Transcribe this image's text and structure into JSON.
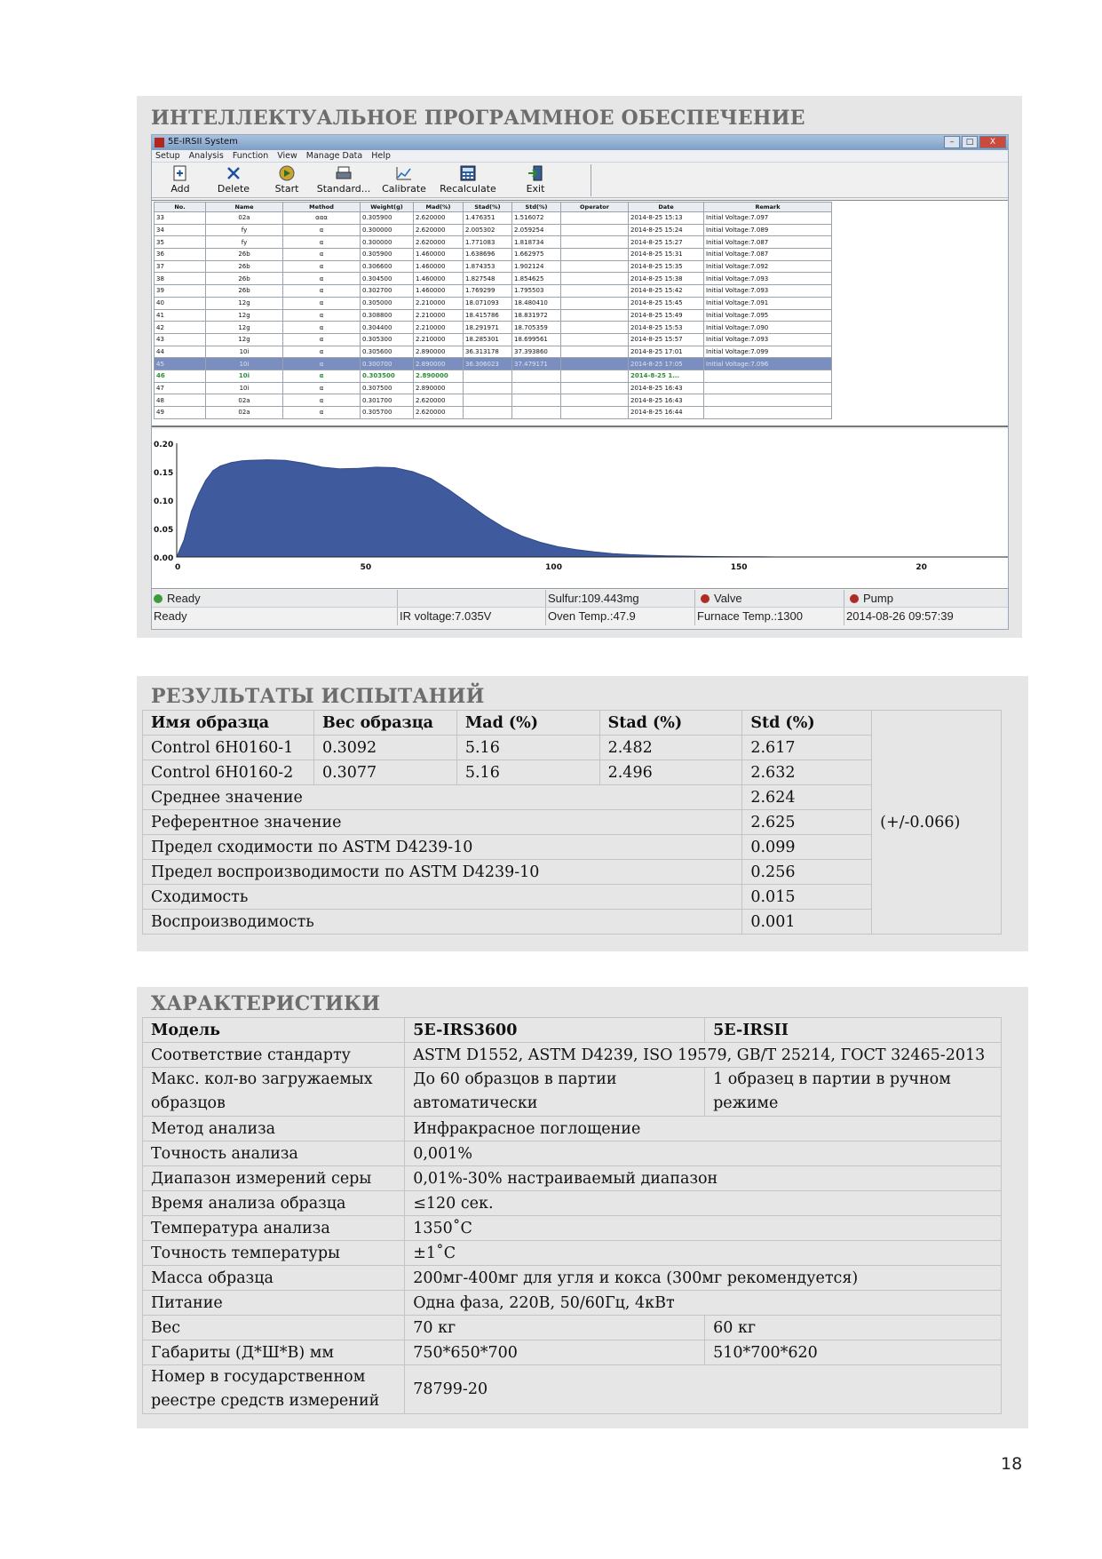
{
  "software_section": {
    "title": "ИНТЕЛЛЕКТУАЛЬНОЕ ПРОГРАММНОЕ ОБЕСПЕЧЕНИЕ",
    "window": {
      "app_title": "5E-IRSII System",
      "window_buttons": [
        "–",
        "□",
        "X"
      ],
      "menu": [
        "Setup",
        "Analysis",
        "Function",
        "View",
        "Manage Data",
        "Help"
      ],
      "toolbar": [
        {
          "label": "Add",
          "icon": "add-icon"
        },
        {
          "label": "Delete",
          "icon": "delete-icon"
        },
        {
          "label": "Start",
          "icon": "start-icon"
        },
        {
          "label": "Standard...",
          "icon": "printer-icon"
        },
        {
          "label": "Calibrate",
          "icon": "calibrate-chart-icon"
        },
        {
          "label": "Recalculate",
          "icon": "calculator-icon"
        },
        {
          "label": "Exit",
          "icon": "exit-icon"
        }
      ],
      "grid": {
        "columns": [
          "No.",
          "Name",
          "Method",
          "Weight(g)",
          "Mad(%)",
          "Stad(%)",
          "Std(%)",
          "Operator",
          "Date",
          "Remark"
        ],
        "rows": [
          [
            "33",
            "02a",
            "ααα",
            "0.305900",
            "2.620000",
            "1.476351",
            "1.516072",
            "",
            "2014-8-25  15:13",
            "Initial Voltage:7.097"
          ],
          [
            "34",
            "fy",
            "α",
            "0.300000",
            "2.620000",
            "2.005302",
            "2.059254",
            "",
            "2014-8-25  15:24",
            "Initial Voltage:7.089"
          ],
          [
            "35",
            "fy",
            "α",
            "0.300000",
            "2.620000",
            "1.771083",
            "1.818734",
            "",
            "2014-8-25  15:27",
            "Initial Voltage:7.087"
          ],
          [
            "36",
            "26b",
            "α",
            "0.305900",
            "1.460000",
            "1.638696",
            "1.662975",
            "",
            "2014-8-25  15:31",
            "Initial Voltage:7.087"
          ],
          [
            "37",
            "26b",
            "α",
            "0.306600",
            "1.460000",
            "1.874353",
            "1.902124",
            "",
            "2014-8-25  15:35",
            "Initial Voltage:7.092"
          ],
          [
            "38",
            "26b",
            "α",
            "0.304500",
            "1.460000",
            "1.827548",
            "1.854625",
            "",
            "2014-8-25  15:38",
            "Initial Voltage:7.093"
          ],
          [
            "39",
            "26b",
            "α",
            "0.302700",
            "1.460000",
            "1.769299",
            "1.795503",
            "",
            "2014-8-25  15:42",
            "Initial Voltage:7.093"
          ],
          [
            "40",
            "12g",
            "α",
            "0.305000",
            "2.210000",
            "18.071093",
            "18.480410",
            "",
            "2014-8-25  15:45",
            "Initial Voltage:7.091"
          ],
          [
            "41",
            "12g",
            "α",
            "0.308800",
            "2.210000",
            "18.415786",
            "18.831972",
            "",
            "2014-8-25  15:49",
            "Initial Voltage:7.095"
          ],
          [
            "42",
            "12g",
            "α",
            "0.304400",
            "2.210000",
            "18.291971",
            "18.705359",
            "",
            "2014-8-25  15:53",
            "Initial Voltage:7.090"
          ],
          [
            "43",
            "12g",
            "α",
            "0.305300",
            "2.210000",
            "18.285301",
            "18.699561",
            "",
            "2014-8-25  15:57",
            "Initial Voltage:7.093"
          ],
          [
            "44",
            "10i",
            "α",
            "0.305600",
            "2.890000",
            "36.313178",
            "37.393860",
            "",
            "2014-8-25  17:01",
            "Initial Voltage:7.099"
          ],
          [
            "45",
            "10i",
            "α",
            "0.300700",
            "2.890000",
            "36.306023",
            "37.479171",
            "",
            "2014-8-25  17:05",
            "Initial Voltage:7.096"
          ],
          [
            "46",
            "10i",
            "α",
            "0.303500",
            "2.890000",
            "",
            "",
            "",
            "2014-8-25  1...",
            ""
          ],
          [
            "47",
            "10i",
            "α",
            "0.307500",
            "2.890000",
            "",
            "",
            "",
            "2014-8-25  16:43",
            ""
          ],
          [
            "48",
            "02a",
            "α",
            "0.301700",
            "2.620000",
            "",
            "",
            "",
            "2014-8-25  16:43",
            ""
          ],
          [
            "49",
            "02a",
            "α",
            "0.305700",
            "2.620000",
            "",
            "",
            "",
            "2014-8-25  16:44",
            ""
          ]
        ]
      },
      "status_bar": {
        "row1": {
          "ready": "Ready",
          "sulfur": "Sulfur:109.443mg",
          "valve": "Valve",
          "pump": "Pump"
        },
        "row2": {
          "ready": "Ready",
          "ir_voltage": "IR voltage:7.035V",
          "oven_temp": "Oven Temp.:47.9",
          "furnace_temp": "Furnace Temp.:1300",
          "datetime": "2014-08-26  09:57:39"
        }
      },
      "colors": {
        "curve_fill": "#3f5b9e",
        "valve_dot": "#b02b23",
        "pump_dot": "#b02b23",
        "ready_dot": "#3a9b3a"
      }
    }
  },
  "chart_data": {
    "type": "area",
    "title": "",
    "xlabel": "",
    "ylabel": "",
    "xlim": [
      0,
      200
    ],
    "ylim": [
      0,
      0.2
    ],
    "x_ticks": [
      "0",
      "50",
      "100",
      "150",
      "20"
    ],
    "y_ticks": [
      "0.00",
      "0.05",
      "0.10",
      "0.15",
      "0.20"
    ],
    "grid": false,
    "series": [
      {
        "x": [
          0,
          2,
          4,
          6,
          8,
          10,
          12,
          15,
          18,
          20,
          25,
          30,
          35,
          40,
          45,
          50,
          55,
          60,
          65,
          70,
          75,
          80,
          85,
          90,
          95,
          100,
          105,
          110,
          115,
          120,
          125,
          130,
          135,
          140,
          145,
          150,
          155,
          160,
          165
        ],
        "y": [
          0,
          0.03,
          0.08,
          0.11,
          0.135,
          0.152,
          0.16,
          0.166,
          0.169,
          0.17,
          0.171,
          0.17,
          0.165,
          0.158,
          0.155,
          0.156,
          0.158,
          0.157,
          0.15,
          0.138,
          0.118,
          0.095,
          0.072,
          0.052,
          0.037,
          0.026,
          0.018,
          0.013,
          0.009,
          0.006,
          0.004,
          0.003,
          0.002,
          0.0015,
          0.001,
          0.0007,
          0.0005,
          0.0003,
          0
        ]
      }
    ]
  },
  "results_section": {
    "title": "РЕЗУЛЬТАТЫ ИСПЫТАНИЙ",
    "headers": [
      "Имя образца",
      "Вес образца",
      "Mad (%)",
      "Stad (%)",
      "Std (%)"
    ],
    "rows": [
      [
        "Control 6H0160-1",
        "0.3092",
        "5.16",
        "2.482",
        "2.617"
      ],
      [
        "Control 6H0160-2",
        "0.3077",
        "5.16",
        "2.496",
        "2.632"
      ]
    ],
    "summary": [
      [
        "Среднее значение",
        "2.624"
      ],
      [
        "Референтное значение",
        "2.625"
      ],
      [
        "Предел сходимости по ASTM D4239-10",
        "0.099"
      ],
      [
        "Предел воспроизводимости по ASTM D4239-10",
        "0.256"
      ],
      [
        "Сходимость",
        "0.015"
      ],
      [
        "Воспроизводимость",
        "0.001"
      ]
    ],
    "tolerance": "(+/-0.066)"
  },
  "specs_section": {
    "title": "ХАРАКТЕРИСТИКИ",
    "header": [
      "Модель",
      "5E-IRS3600",
      "5E-IRSII"
    ],
    "rows": [
      {
        "label": "Соответствие стандарту",
        "span": "ASTM D1552, ASTM D4239, ISO 19579, GB/T 25214, ГОСТ 32465-2013"
      },
      {
        "label": "Макс. кол-во загружаемых образцов",
        "a": "До 60 образцов в партии автоматически",
        "b": "1 образец в партии в ручном режиме"
      },
      {
        "label": "Метод анализа",
        "span": "Инфракрасное поглощение"
      },
      {
        "label": "Точность анализа",
        "span": "0,001%"
      },
      {
        "label": "Диапазон измерений серы",
        "span": "0,01%-30% настраиваемый диапазон"
      },
      {
        "label": "Время анализа образца",
        "span": "≤120 сек."
      },
      {
        "label": "Температура анализа",
        "span": "1350˚C"
      },
      {
        "label": "Точность температуры",
        "span": "±1˚C"
      },
      {
        "label": "Масса образца",
        "span": "200мг-400мг для угля и кокса (300мг рекомендуется)"
      },
      {
        "label": "Питание",
        "span": "Одна фаза, 220В, 50/60Гц, 4кВт"
      },
      {
        "label": "Вес",
        "a": "70 кг",
        "b": "60 кг"
      },
      {
        "label": "Габариты (Д*Ш*В) мм",
        "a": "750*650*700",
        "b": "510*700*620"
      },
      {
        "label": "Номер в государственном реестре средств измерений",
        "span": "78799-20"
      }
    ]
  },
  "page_number": "18"
}
